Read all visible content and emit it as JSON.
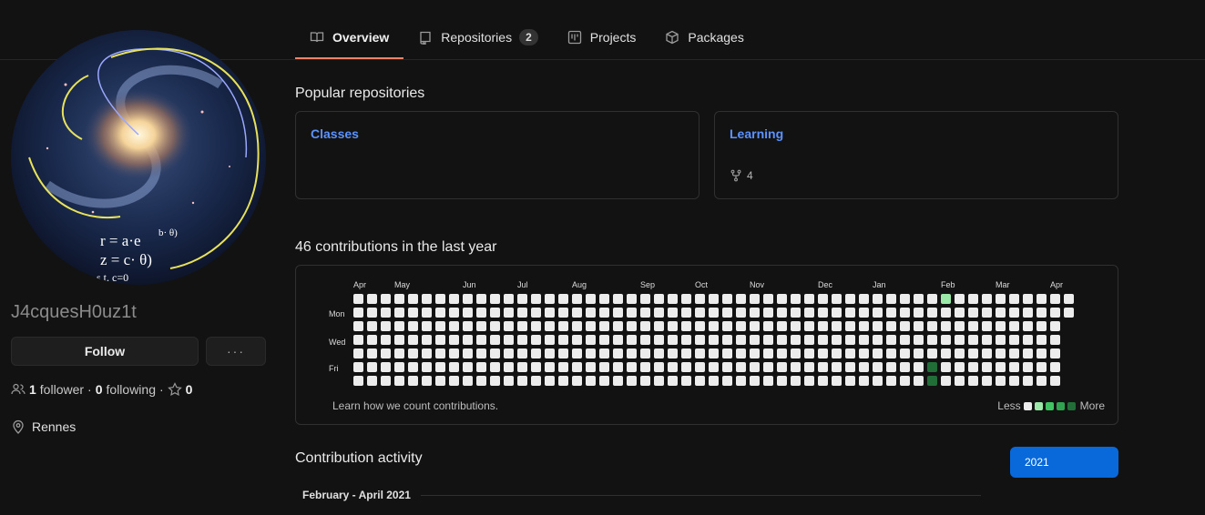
{
  "tabs": [
    {
      "label": "Overview",
      "icon": "book-icon",
      "active": true
    },
    {
      "label": "Repositories",
      "icon": "repo-icon",
      "count": "2"
    },
    {
      "label": "Projects",
      "icon": "project-icon"
    },
    {
      "label": "Packages",
      "icon": "package-icon"
    }
  ],
  "profile": {
    "username": "J4cquesH0uz1t",
    "follow_label": "Follow",
    "more_label": "···",
    "followers_count": "1",
    "followers_label": "follower",
    "following_count": "0",
    "following_label": "following",
    "stars_count": "0",
    "location": "Rennes",
    "avatar_formula_1": "r = a·e",
    "avatar_formula_1_sup": "b· θ)",
    "avatar_formula_2": "z = c· θ)",
    "avatar_formula_3": "s.t. c=0"
  },
  "popular": {
    "title": "Popular repositories",
    "repos": [
      {
        "name": "Classes"
      },
      {
        "name": "Learning",
        "forks": "4"
      }
    ]
  },
  "contributions": {
    "title": "46 contributions in the last year",
    "months": [
      "Apr",
      "May",
      "Jun",
      "Jul",
      "Aug",
      "Sep",
      "Oct",
      "Nov",
      "Dec",
      "Jan",
      "Feb",
      "Mar",
      "Apr"
    ],
    "days": [
      "Mon",
      "Wed",
      "Fri"
    ],
    "learn_text": "Learn how we count contributions.",
    "less_label": "Less",
    "more_label": "More",
    "colors": {
      "empty": "#ececec",
      "l1": "#9be9a8",
      "l2": "#40c463",
      "l3": "#30a14e",
      "l4": "#216e39"
    },
    "weeks": 53,
    "last_week_days": 2,
    "highlighted": [
      {
        "week": 43,
        "day": 0,
        "level": 1
      },
      {
        "week": 42,
        "day": 5,
        "level": 4
      },
      {
        "week": 42,
        "day": 6,
        "level": 4
      }
    ]
  },
  "activity": {
    "title": "Contribution activity",
    "year": "2021",
    "period": "February - April 2021"
  }
}
